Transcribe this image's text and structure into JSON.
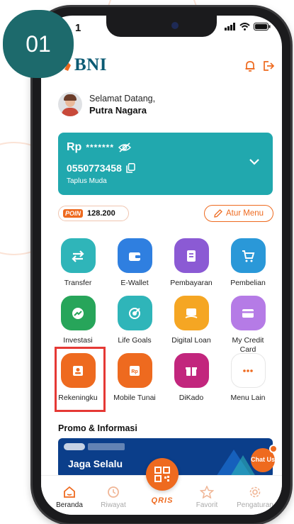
{
  "step_badge": "01",
  "status": {
    "time": "1"
  },
  "brand": {
    "name": "BNI"
  },
  "greeting": {
    "line1": "Selamat Datang,",
    "name": "Putra Nagara"
  },
  "account": {
    "currency": "Rp",
    "balance_masked": "*******",
    "number": "0550773458",
    "type": "Taplus Muda"
  },
  "poin": {
    "logo": "POIN",
    "value": "128.200"
  },
  "atur_menu": {
    "label": "Atur Menu"
  },
  "menu": [
    {
      "label": "Transfer",
      "icon": "transfer-icon",
      "color": "#2fb5b9"
    },
    {
      "label": "E-Wallet",
      "icon": "wallet-icon",
      "color": "#2f7fe0"
    },
    {
      "label": "Pembayaran",
      "icon": "bill-icon",
      "color": "#8b5ad4"
    },
    {
      "label": "Pembelian",
      "icon": "cart-icon",
      "color": "#2a98d8"
    },
    {
      "label": "Investasi",
      "icon": "chart-up-icon",
      "color": "#27a55a"
    },
    {
      "label": "Life Goals",
      "icon": "target-icon",
      "color": "#2fb5b9"
    },
    {
      "label": "Digital Loan",
      "icon": "loan-icon",
      "color": "#f5a623"
    },
    {
      "label": "My Credit Card",
      "icon": "credit-card-icon",
      "color": "#b57be6"
    },
    {
      "label": "Rekeningku",
      "icon": "account-icon",
      "color": "#ee6a1f"
    },
    {
      "label": "Mobile Tunai",
      "icon": "cash-icon",
      "color": "#ee6a1f"
    },
    {
      "label": "DiKado",
      "icon": "gift-icon",
      "color": "#c2267d"
    },
    {
      "label": "Menu Lain",
      "icon": "more-icon",
      "color": "#ee6a1f"
    }
  ],
  "promo": {
    "title": "Promo & Informasi",
    "banner_text": "Jaga Selalu",
    "chat_label": "Chat Us"
  },
  "tabs": [
    {
      "label": "Beranda",
      "icon": "home-icon",
      "active": true
    },
    {
      "label": "Riwayat",
      "icon": "history-icon",
      "active": false
    },
    {
      "label": "QRIS",
      "icon": "qris-icon",
      "active": false
    },
    {
      "label": "Favorit",
      "icon": "star-icon",
      "active": false
    },
    {
      "label": "Pengaturan",
      "icon": "settings-icon",
      "active": false
    }
  ],
  "colors": {
    "accent": "#ee6a1f",
    "teal": "#21a8ae",
    "brand": "#0b5a73",
    "highlight": "#e53935"
  }
}
